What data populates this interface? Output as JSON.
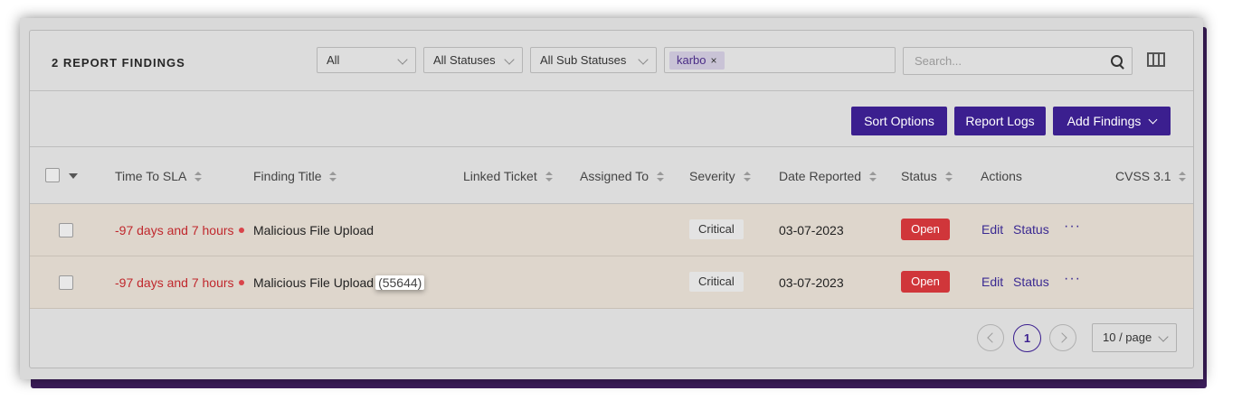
{
  "header": {
    "title": "2 REPORT FINDINGS",
    "filters": {
      "type": "All",
      "status": "All Statuses",
      "sub_status": "All Sub Statuses"
    },
    "tag": "karbo",
    "tag_remove": "×",
    "search_placeholder": "Search..."
  },
  "toolbar": {
    "sort_options": "Sort Options",
    "report_logs": "Report Logs",
    "add_findings": "Add Findings"
  },
  "columns": [
    "Time To SLA",
    "Finding Title",
    "Linked Ticket",
    "Assigned To",
    "Severity",
    "Date Reported",
    "Status",
    "Actions",
    "CVSS 3.1"
  ],
  "rows": [
    {
      "sla": "-97 days and 7 hours",
      "title": "Malicious File Upload",
      "id": "",
      "severity": "Critical",
      "date": "03-07-2023",
      "status": "Open",
      "edit": "Edit",
      "status_action": "Status",
      "more": "···"
    },
    {
      "sla": "-97 days and 7 hours",
      "title": "Malicious File Upload",
      "id": "(55644)",
      "severity": "Critical",
      "date": "03-07-2023",
      "status": "Open",
      "edit": "Edit",
      "status_action": "Status",
      "more": "···"
    }
  ],
  "pagination": {
    "current": "1",
    "page_size": "10 / page"
  },
  "colors": {
    "accent": "#3b1f8f",
    "status_open": "#d0363a",
    "sla_overdue": "#c0282d",
    "row_bg": "#ded6cc"
  },
  "icons": [
    "chevron-down-icon",
    "close-icon",
    "search-icon",
    "columns-icon",
    "sort-icon",
    "chevron-left-icon",
    "chevron-right-icon",
    "more-icon"
  ]
}
